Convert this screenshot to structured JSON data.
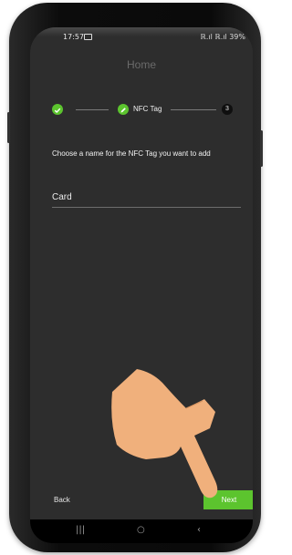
{
  "status_bar": {
    "time": "17:57",
    "right": "ℝ.ıl ℝ.ıl 39%"
  },
  "app_bar": {
    "title": "Home"
  },
  "stepper": {
    "step2_label": "NFC Tag",
    "step3_number": "3"
  },
  "form": {
    "prompt": "Choose a name for the NFC Tag you want to add",
    "name_value": "Card"
  },
  "actions": {
    "back_label": "Back",
    "next_label": "Next"
  },
  "colors": {
    "accent": "#5cc42e",
    "background": "#2d2d2d",
    "hand": "#f0b07c"
  },
  "icons": {
    "step1": "check-circle-icon",
    "step2": "pencil-circle-icon",
    "hand": "pointing-hand-icon",
    "nav_recents": "recents-icon",
    "nav_home": "home-icon",
    "nav_back": "back-icon"
  }
}
